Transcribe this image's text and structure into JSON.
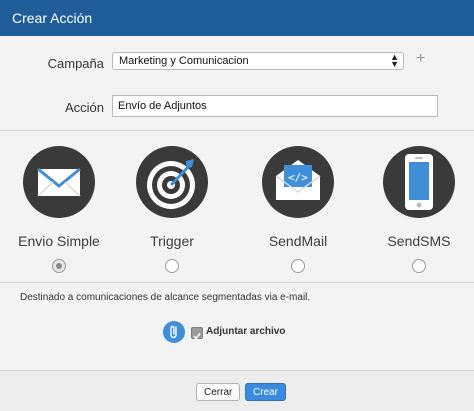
{
  "dialog": {
    "title": "Crear Acción"
  },
  "form": {
    "campaign_label": "Campaña",
    "campaign_value": "Marketing y Comunicacion",
    "add_symbol": "+",
    "action_label": "Acción",
    "action_value": "Envío de Adjuntos"
  },
  "options": [
    {
      "label": "Envio Simple",
      "icon": "envelope-icon",
      "selected": true
    },
    {
      "label": "Trigger",
      "icon": "target-icon",
      "selected": false
    },
    {
      "label": "SendMail",
      "icon": "code-mail-icon",
      "selected": false
    },
    {
      "label": "SendSMS",
      "icon": "phone-icon",
      "selected": false
    }
  ],
  "description": "Destinado a comunicaciones de alcance segmentadas via e-mail.",
  "attachment": {
    "label": "Adjuntar archivo",
    "checked": true,
    "icon": "paperclip-icon"
  },
  "footer": {
    "cancel_label": "Cerrar",
    "create_label": "Crear"
  },
  "colors": {
    "title_bar": "#1f5d99",
    "icon_circle": "#3a3a3a",
    "accent": "#3b8ae0",
    "icon_blue": "#3e8fd8"
  }
}
